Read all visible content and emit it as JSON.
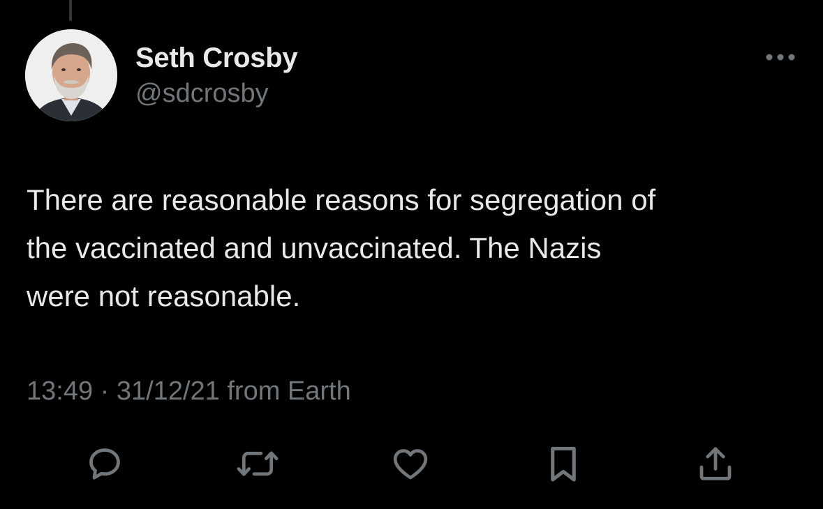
{
  "tweet": {
    "author": {
      "display_name": "Seth Crosby",
      "handle": "@sdcrosby",
      "avatar_icon": "profile-photo"
    },
    "text": "There are reasonable reasons for segregation of\nthe vaccinated and unvaccinated. The Nazis\nwere not reasonable.",
    "time": "13:49",
    "separator": "·",
    "date": "31/12/21",
    "source": "from Earth"
  },
  "actions": [
    {
      "icon": "reply-icon",
      "label": "Reply"
    },
    {
      "icon": "retweet-icon",
      "label": "Repost"
    },
    {
      "icon": "like-icon",
      "label": "Like"
    },
    {
      "icon": "bookmark-icon",
      "label": "Bookmark"
    },
    {
      "icon": "share-icon",
      "label": "Share"
    }
  ],
  "colors": {
    "background": "#000000",
    "primary_text": "#e7e9ea",
    "secondary_text": "#71767b",
    "thread_line": "#333639"
  }
}
